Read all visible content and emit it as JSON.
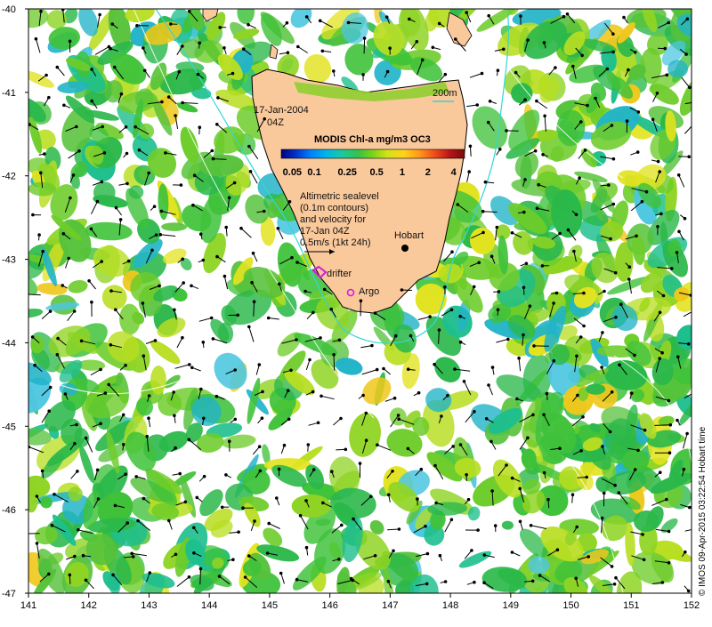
{
  "map": {
    "date_line": "17-Jan-2004",
    "time_line": "04Z",
    "colorbar_title": "MODIS Chl-a mg/m3 OC3",
    "colorbar_ticks": [
      "0.05",
      "0.1",
      "0.25",
      "0.5",
      "1",
      "2",
      "4"
    ],
    "colorbar_colors": [
      "#000080",
      "#0033cc",
      "#0080ff",
      "#00b7e6",
      "#19c9a0",
      "#36c24a",
      "#7dd31a",
      "#d4e21a",
      "#ffd21a",
      "#ff9a1a",
      "#ef4a1a",
      "#b8141a",
      "#7a0a0a"
    ],
    "depth_label": "200m",
    "depth_color": "#33d6d6",
    "legend_lines": [
      "Altimetric sealevel",
      "(0.1m contours)",
      "and velocity for",
      "17-Jan 04Z",
      "0.5m/s (1kt 24h)"
    ],
    "place_hobart": "Hobart",
    "label_drifter": "drifter",
    "label_argo": "Argo",
    "credit": "© IMOS 09-Apr-2015 03:22:54 Hobart time",
    "land_color": "#f9c89b",
    "marker_color": "#d81ad8",
    "x_ticks": [
      "141",
      "142",
      "143",
      "144",
      "145",
      "146",
      "147",
      "148",
      "149",
      "150",
      "151",
      "152"
    ],
    "y_ticks": [
      "-40",
      "-41",
      "-42",
      "-43",
      "-44",
      "-45",
      "-46",
      "-47"
    ],
    "lon_range": [
      141,
      152
    ],
    "lat_range": [
      -47,
      -40
    ]
  }
}
